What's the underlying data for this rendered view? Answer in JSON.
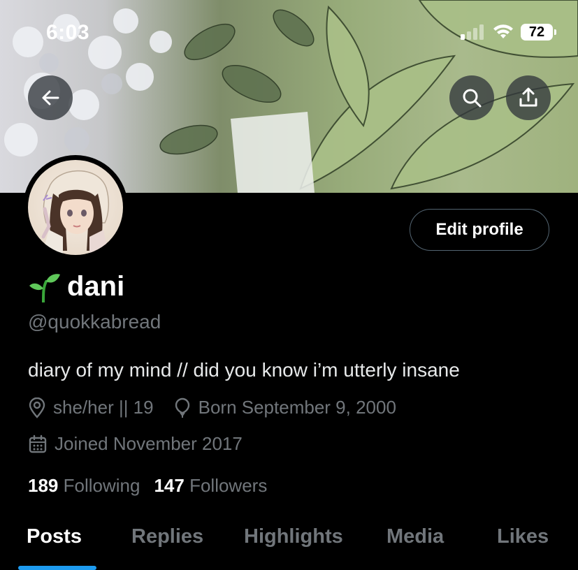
{
  "status_bar": {
    "time": "6:03",
    "battery": "72"
  },
  "header": {
    "back_icon": "arrow-left-icon",
    "search_icon": "search-icon",
    "share_icon": "share-upload-icon"
  },
  "profile": {
    "name_emoji": "🌱",
    "display_name": "dani",
    "handle": "@quokkabread",
    "edit_label": "Edit profile",
    "bio": "diary of my mind // did you know i’m utterly insane",
    "location": "she/her || 19",
    "birthday": "Born September 9, 2000",
    "joined": "Joined November 2017",
    "following_count": "189",
    "following_label": "Following",
    "followers_count": "147",
    "followers_label": "Followers"
  },
  "tabs": [
    {
      "label": "Posts",
      "active": true
    },
    {
      "label": "Replies",
      "active": false
    },
    {
      "label": "Highlights",
      "active": false
    },
    {
      "label": "Media",
      "active": false
    },
    {
      "label": "Likes",
      "active": false
    }
  ],
  "colors": {
    "accent": "#1d9bf0",
    "muted": "#71767b",
    "background": "#000000"
  }
}
